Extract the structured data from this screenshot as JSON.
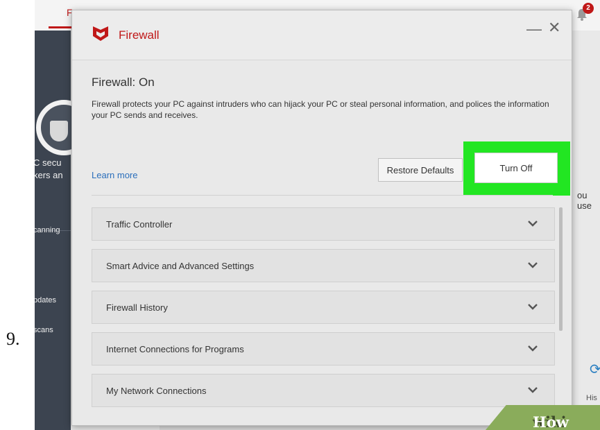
{
  "step": {
    "number": "9."
  },
  "background_app": {
    "tab_fragment": "F",
    "notification_count": "2",
    "sidebar_text": {
      "security_line1": "C secu",
      "security_line2": "kers an",
      "scanning": "canning",
      "updates": "pdates",
      "scans": "scans"
    },
    "right_text": "ou use",
    "right_label": "His"
  },
  "dialog": {
    "title": "Firewall",
    "minimize": "—",
    "close": "✕",
    "status_title": "Firewall: On",
    "status_description": "Firewall protects your PC against intruders who can hijack your PC or steal personal information, and polices the information your PC sends and receives.",
    "learn_more": "Learn more",
    "restore_defaults": "Restore Defaults",
    "turn_off": "Turn Off",
    "sections": [
      {
        "label": "Traffic Controller"
      },
      {
        "label": "Smart Advice and Advanced Settings"
      },
      {
        "label": "Firewall History"
      },
      {
        "label": "Internet Connections for Programs"
      },
      {
        "label": "My Network Connections"
      }
    ]
  },
  "watermark": {
    "part1": "wiki",
    "part2": "How"
  },
  "colors": {
    "brand_red": "#c01818",
    "highlight_green": "#22e622",
    "link_blue": "#2a6ebb",
    "sidebar_dark": "#3c4450"
  },
  "icons": {
    "logo": "mcafee-shield-logo-icon",
    "bell": "bell-icon",
    "chevron": "chevron-down-icon",
    "shield": "shield-icon",
    "refresh": "refresh-icon"
  }
}
